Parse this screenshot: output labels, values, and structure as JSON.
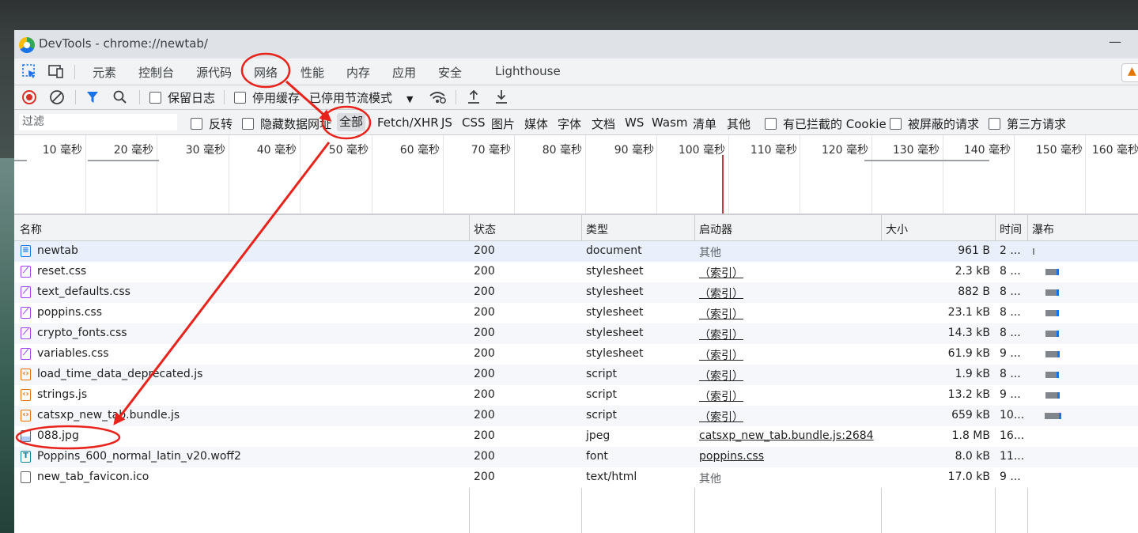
{
  "window": {
    "title": "DevTools - chrome://newtab/",
    "minimize_glyph": "—"
  },
  "panel_tabs": [
    {
      "label": "元素"
    },
    {
      "label": "控制台"
    },
    {
      "label": "源代码"
    },
    {
      "label": "网络",
      "active": true
    },
    {
      "label": "性能"
    },
    {
      "label": "内存"
    },
    {
      "label": "应用"
    },
    {
      "label": "安全"
    },
    {
      "label": "Lighthouse"
    }
  ],
  "toolbar": {
    "preserve_log": "保留日志",
    "disable_cache": "停用缓存",
    "throttling": "已停用节流模式"
  },
  "filter": {
    "placeholder": "过滤",
    "invert": "反转",
    "hide_data_urls": "隐藏数据网址",
    "types": [
      "全部",
      "Fetch/XHR",
      "JS",
      "CSS",
      "图片",
      "媒体",
      "字体",
      "文档",
      "WS",
      "Wasm",
      "清单",
      "其他"
    ],
    "blocked_cookies": "有已拦截的 Cookie",
    "blocked_requests": "被屏蔽的请求",
    "third_party": "第三方请求"
  },
  "timeline_ticks": [
    "10 毫秒",
    "20 毫秒",
    "30 毫秒",
    "40 毫秒",
    "50 毫秒",
    "60 毫秒",
    "70 毫秒",
    "80 毫秒",
    "90 毫秒",
    "100 毫秒",
    "110 毫秒",
    "120 毫秒",
    "130 毫秒",
    "140 毫秒",
    "150 毫秒",
    "160 毫秒"
  ],
  "columns": {
    "name": "名称",
    "status": "状态",
    "type": "类型",
    "initiator": "启动器",
    "size": "大小",
    "time": "时间",
    "waterfall": "瀑布"
  },
  "requests": [
    {
      "name": "newtab",
      "icon": "document-icon",
      "status": "200",
      "type": "document",
      "initiator": "其他",
      "size": "961 B",
      "time": "2 ..."
    },
    {
      "name": "reset.css",
      "icon": "stylesheet-icon",
      "status": "200",
      "type": "stylesheet",
      "initiator": "（索引）",
      "size": "2.3 kB",
      "time": "8 ..."
    },
    {
      "name": "text_defaults.css",
      "icon": "stylesheet-icon",
      "status": "200",
      "type": "stylesheet",
      "initiator": "（索引）",
      "size": "882 B",
      "time": "8 ..."
    },
    {
      "name": "poppins.css",
      "icon": "stylesheet-icon",
      "status": "200",
      "type": "stylesheet",
      "initiator": "（索引）",
      "size": "23.1 kB",
      "time": "8 ..."
    },
    {
      "name": "crypto_fonts.css",
      "icon": "stylesheet-icon",
      "status": "200",
      "type": "stylesheet",
      "initiator": "（索引）",
      "size": "14.3 kB",
      "time": "8 ..."
    },
    {
      "name": "variables.css",
      "icon": "stylesheet-icon",
      "status": "200",
      "type": "stylesheet",
      "initiator": "（索引）",
      "size": "61.9 kB",
      "time": "9 ..."
    },
    {
      "name": "load_time_data_deprecated.js",
      "icon": "script-icon",
      "status": "200",
      "type": "script",
      "initiator": "（索引）",
      "size": "1.9 kB",
      "time": "8 ..."
    },
    {
      "name": "strings.js",
      "icon": "script-icon",
      "status": "200",
      "type": "script",
      "initiator": "（索引）",
      "size": "13.2 kB",
      "time": "9 ..."
    },
    {
      "name": "catsxp_new_tab.bundle.js",
      "icon": "script-icon",
      "status": "200",
      "type": "script",
      "initiator": "（索引）",
      "size": "659 kB",
      "time": "10..."
    },
    {
      "name": "088.jpg",
      "icon": "image-icon",
      "status": "200",
      "type": "jpeg",
      "initiator": "catsxp_new_tab.bundle.js:2684",
      "size": "1.8 MB",
      "time": "16..."
    },
    {
      "name": "Poppins_600_normal_latin_v20.woff2",
      "icon": "font-icon",
      "status": "200",
      "type": "font",
      "initiator": "poppins.css",
      "size": "8.0 kB",
      "time": "11..."
    },
    {
      "name": "new_tab_favicon.ico",
      "icon": "file-icon",
      "status": "200",
      "type": "text/html",
      "initiator": "其他",
      "size": "17.0 kB",
      "time": "9 ..."
    }
  ],
  "colors": {
    "accent": "#1a73e8",
    "record": "#d93025",
    "annotation": "#e8231b",
    "timeline_marker": "#c5393e"
  }
}
